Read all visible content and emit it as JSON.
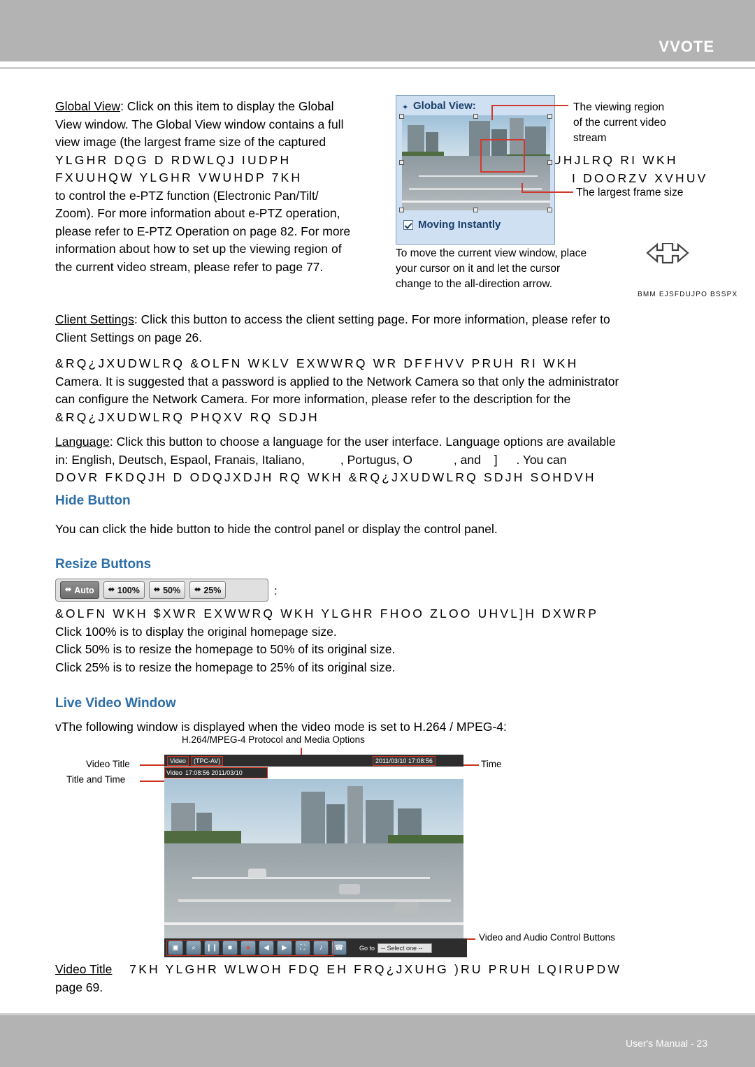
{
  "header": {
    "brand": "VVOTE"
  },
  "footer": {
    "text": "User's Manual - 23"
  },
  "body": {
    "global_view_label": "Global View",
    "p1_line1_rest": ": Click on this item to display the Global",
    "p1_line2": "View window. The Global View window contains a full",
    "p1_line3": "view image (the largest frame size of the captured",
    "p1_line4": "YLGHR DQG D RDWLQJ IUDPH",
    "p1_line4_right": "UHJLRQ RI WKH",
    "p1_line5": "FXUUHQW YLGHR VWUHDP  7KH",
    "p1_line5_right": "I DOORZV XVHUV",
    "p1_line6": "to control the e-PTZ function (Electronic Pan/Tilt/",
    "p1_line7": "Zoom). For more information about e-PTZ operation,",
    "p1_line8": "please refer to E-PTZ Operation on page 82. For more",
    "p1_line9": "information about how to set up the viewing region of",
    "p1_line10": "the current video stream, please refer to page 77.",
    "callout_right_1": "The viewing region",
    "callout_right_2": "of the current video",
    "callout_right_3": "stream",
    "callout_frame": "The largest frame size",
    "callout_move_1": "To move the current view window, place",
    "callout_move_2": "your cursor on it and let the cursor",
    "callout_move_3": "change to the all-direction arrow.",
    "arrow_caption": "BMM EJSFDUJPO BSSPX",
    "garbled_line": "                 ",
    "client_settings_label": "Client Settings",
    "p2_line1_rest": ": Click this button to access the client setting page. For more information, please refer to",
    "p2_line2": "Client Settings on page 26.",
    "p3_line1": "&RQ¿JXUDWLRQ  &OLFN WKLV EXWWRQ WR DFFHVV PRUH RI WKH",
    "p3_line2": "Camera. It is suggested that a password is applied to the Network Camera so that only the administrator",
    "p3_line3": "can configure the Network Camera. For more information, please refer to the description for the",
    "p3_line4": "&RQ¿JXUDWLRQ PHQXV RQ SDJH",
    "language_label": "Language",
    "p4_line1_rest": ": Click this button to choose a language for the user interface. Language options are available",
    "p4_line2_a": "in: English, Deutsch, Espa",
    "p4_line2_b": "ol, Fran",
    "p4_line2_c": "ais, Italiano,",
    "p4_line2_d": ", Portugu",
    "p4_line2_e": "s, O",
    "p4_line2_f": ", and",
    "p4_line2_g": "]",
    "p4_line2_h": ". You can",
    "p4_line3": "DOVR FKDQJH D ODQJXDJH RQ WKH &RQ¿JXUDWLRQ SDJH  SOHDVH",
    "hide_button_heading": "Hide Button",
    "hide_button_text": "You can click the hide button to hide the control panel or display the control panel.",
    "resize_heading": "Resize Buttons",
    "resize_colon": ":",
    "resize_line1": "&OLFN WKH $XWR EXWWRQ  WKH YLGHR FHOO ZLOO UHVL]H DXWRP",
    "resize_line2": "Click 100% is to display the original homepage size.",
    "resize_line3": "Click 50% is to resize the homepage to 50% of its original size.",
    "resize_line4": "Click 25% is to resize the homepage to 25% of its original size.",
    "live_video_heading": "Live Video Window",
    "live_video_intro": "vThe following window is displayed when the video mode is set to H.264 / MPEG-4:",
    "fig_protocol": "H.264/MPEG-4 Protocol and Media Options",
    "fig_video_title": "Video Title",
    "fig_title_and_time": "Title and Time",
    "fig_time": "Time",
    "fig_controls": "Video and Audio Control Buttons",
    "last_label": "Video Title",
    "last_line_rest": "7KH YLGHR WLWOH FDQ EH FRQ¿JXUHG  )RU PRUH LQIRUPDW",
    "last_line2": "page 69."
  },
  "global_view_figure": {
    "title": "Global View:",
    "checkbox_label": "Moving Instantly",
    "checkbox_checked": true
  },
  "live_video_figure": {
    "tag_video": "Video",
    "tag_protocol": "(TPC-AV)",
    "timestamp_top": "2011/03/10  17:08:56",
    "second_bar_video": "Video",
    "second_bar_time": "17:08:56  2011/03/10",
    "goto_label": "Go to",
    "goto_select": "-- Select one --",
    "control_buttons": [
      "snapshot-icon",
      "zoom-icon",
      "pause-icon",
      "stop-icon",
      "record-icon",
      "volume-icon",
      "play-icon",
      "fullscreen-icon",
      "mic-icon",
      "talk-icon"
    ]
  },
  "resize_buttons": {
    "items": [
      {
        "label": "Auto",
        "active": true
      },
      {
        "label": "100%",
        "active": false
      },
      {
        "label": "50%",
        "active": false
      },
      {
        "label": "25%",
        "active": false
      }
    ]
  },
  "colors": {
    "heading": "#2e6fa8",
    "header_bar": "#b3b3b3",
    "accent_red": "#cc3322",
    "figure_bg": "#cfe0f2"
  }
}
